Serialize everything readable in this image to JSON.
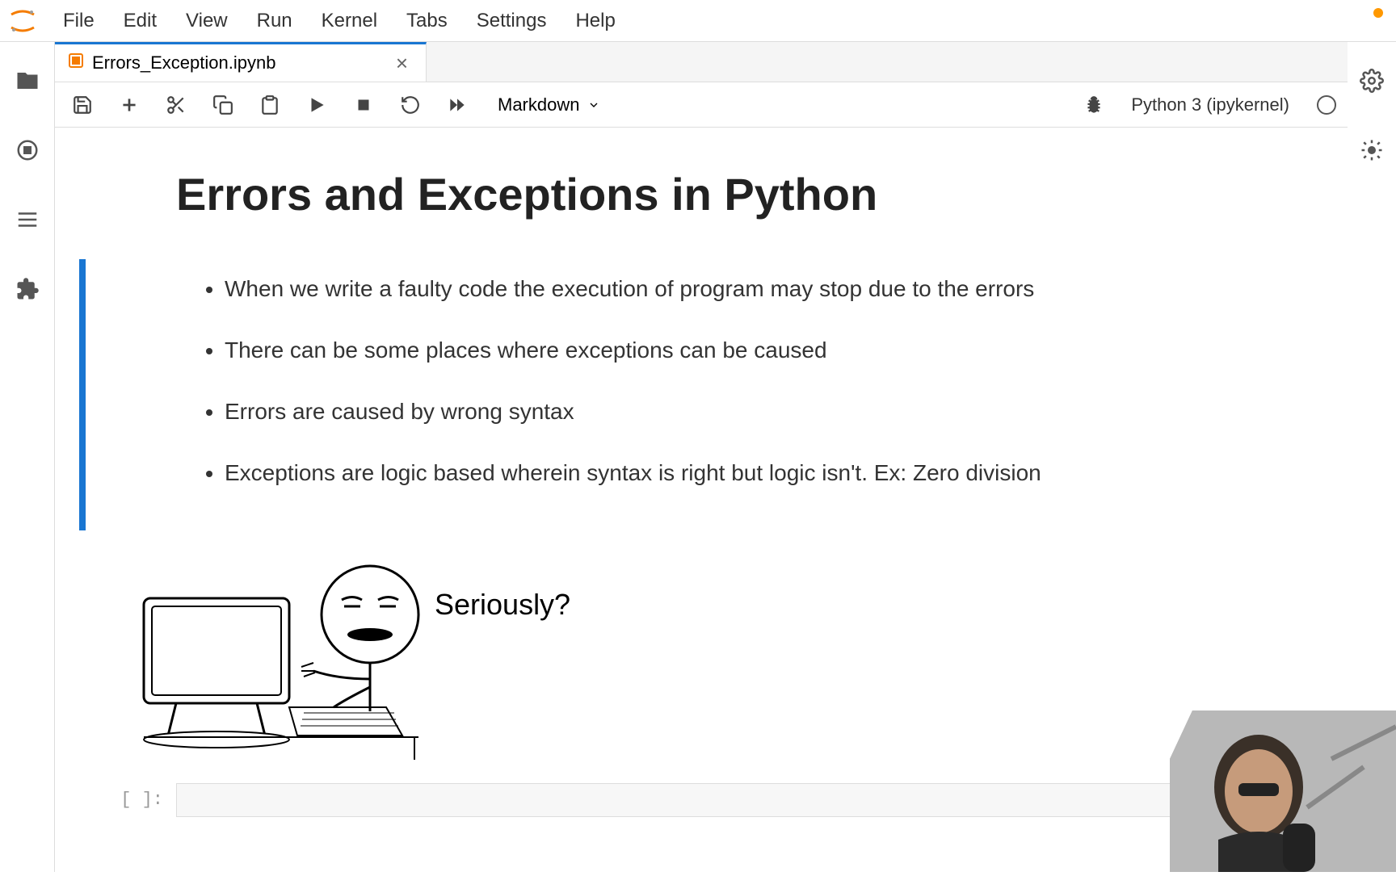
{
  "menubar": {
    "items": [
      "File",
      "Edit",
      "View",
      "Run",
      "Kernel",
      "Tabs",
      "Settings",
      "Help"
    ]
  },
  "tab": {
    "label": "Errors_Exception.ipynb"
  },
  "toolbar": {
    "cell_type": "Markdown",
    "kernel_name": "Python 3 (ipykernel)"
  },
  "notebook": {
    "title": "Errors and Exceptions in Python",
    "bullets": [
      "When we write a faulty code the execution of program may stop due to the errors",
      "There can be some places where exceptions can be caused",
      "Errors are caused by wrong syntax",
      "Exceptions are logic based wherein syntax is right but logic isn't. Ex: Zero division"
    ],
    "meme_text": "Seriously?",
    "code_prompt": "[ ]:"
  }
}
